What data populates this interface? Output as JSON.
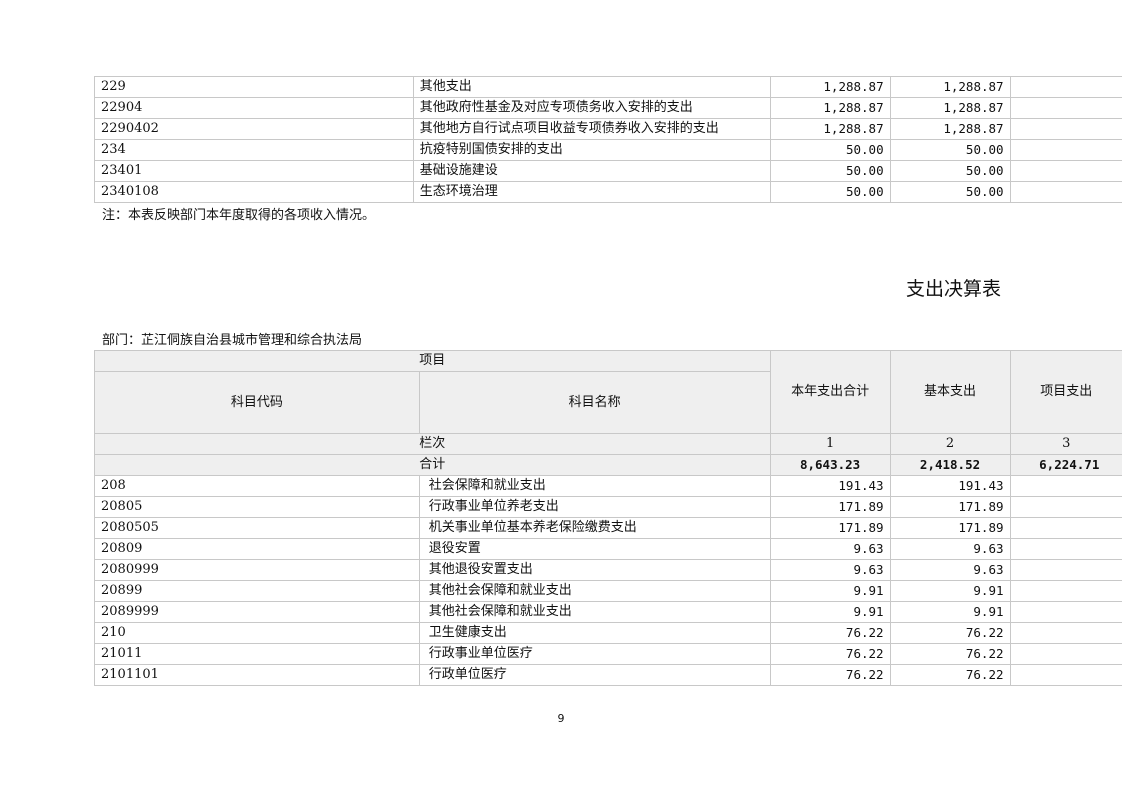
{
  "top_table": {
    "rows": [
      {
        "code": "229",
        "name": "其他支出",
        "total": "1,288.87",
        "basic": "1,288.87"
      },
      {
        "code": "22904",
        "name": "其他政府性基金及对应专项债务收入安排的支出",
        "total": "1,288.87",
        "basic": "1,288.87"
      },
      {
        "code": "2290402",
        "name": "其他地方自行试点项目收益专项债券收入安排的支出",
        "total": "1,288.87",
        "basic": "1,288.87"
      },
      {
        "code": "234",
        "name": "抗疫特别国债安排的支出",
        "total": "50.00",
        "basic": "50.00"
      },
      {
        "code": "23401",
        "name": "基础设施建设",
        "total": "50.00",
        "basic": "50.00"
      },
      {
        "code": "2340108",
        "name": "生态环境治理",
        "total": "50.00",
        "basic": "50.00"
      }
    ]
  },
  "note": "注：本表反映部门本年度取得的各项收入情况。",
  "title": "支出决算表",
  "department": "部门：芷江侗族自治县城市管理和综合执法局",
  "expense_table": {
    "header": {
      "item": "项目",
      "code": "科目代码",
      "name": "科目名称",
      "total": "本年支出合计",
      "basic": "基本支出",
      "project": "项目支出"
    },
    "column_row": {
      "label": "栏次",
      "c1": "1",
      "c2": "2",
      "c3": "3"
    },
    "total_row": {
      "label": "合计",
      "total": "8,643.23",
      "basic": "2,418.52",
      "project": "6,224.71"
    },
    "rows": [
      {
        "code": "208",
        "name": "社会保障和就业支出",
        "total": "191.43",
        "basic": "191.43"
      },
      {
        "code": "20805",
        "name": "行政事业单位养老支出",
        "total": "171.89",
        "basic": "171.89"
      },
      {
        "code": "2080505",
        "name": "机关事业单位基本养老保险缴费支出",
        "total": "171.89",
        "basic": "171.89"
      },
      {
        "code": "20809",
        "name": "退役安置",
        "total": "9.63",
        "basic": "9.63"
      },
      {
        "code": "2080999",
        "name": "其他退役安置支出",
        "total": "9.63",
        "basic": "9.63"
      },
      {
        "code": "20899",
        "name": "其他社会保障和就业支出",
        "total": "9.91",
        "basic": "9.91"
      },
      {
        "code": "2089999",
        "name": "其他社会保障和就业支出",
        "total": "9.91",
        "basic": "9.91"
      },
      {
        "code": "210",
        "name": "卫生健康支出",
        "total": "76.22",
        "basic": "76.22"
      },
      {
        "code": "21011",
        "name": "行政事业单位医疗",
        "total": "76.22",
        "basic": "76.22"
      },
      {
        "code": "2101101",
        "name": "行政单位医疗",
        "total": "76.22",
        "basic": "76.22"
      }
    ]
  },
  "page_number": "9"
}
